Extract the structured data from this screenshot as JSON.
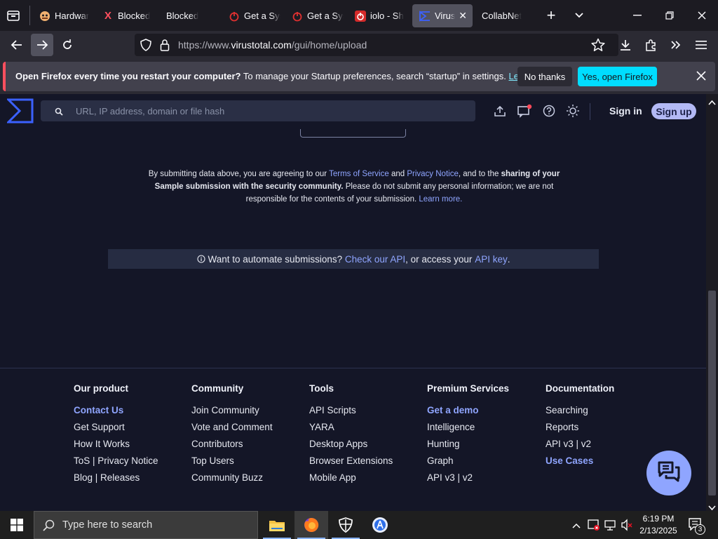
{
  "browser": {
    "tabs": [
      {
        "label": "Hardwar",
        "icon": "smiley-favicon-icon"
      },
      {
        "label": "Blocked",
        "icon": "x-favicon-icon"
      },
      {
        "label": "Blocked",
        "icon": ""
      },
      {
        "label": "Get a Sys",
        "icon": "power-favicon-icon"
      },
      {
        "label": "Get a Sys",
        "icon": "power-favicon-icon"
      },
      {
        "label": "iolo - Sh",
        "icon": "power-square-favicon-icon"
      },
      {
        "label": "Virus",
        "icon": "virustotal-favicon-icon"
      },
      {
        "label": "CollabNet",
        "icon": ""
      }
    ],
    "url_prefix": "https://www.",
    "url_domain": "virustotal.com",
    "url_path": "/gui/home/upload"
  },
  "notification": {
    "bold_text": "Open Firefox every time you restart your computer?",
    "text": " To manage your Startup preferences, search “startup” in settings.",
    "learn_more": "Learn more",
    "no_thanks": "No thanks",
    "yes": "Yes, open Firefox"
  },
  "header": {
    "search_placeholder": "URL, IP address, domain or file hash",
    "sign_in": "Sign in",
    "sign_up": "Sign up"
  },
  "terms": {
    "p1": "By submitting data above, you are agreeing to our ",
    "tos": "Terms of Service",
    "and": " and ",
    "privacy": "Privacy Notice",
    "p2": ", and to the ",
    "bold": "sharing of your Sample submission with the security community.",
    "p3": " Please do not submit any personal information; we are not responsible for the contents of your submission. ",
    "learn_more": "Learn more."
  },
  "api_banner": {
    "icon": "info-icon",
    "text1": "Want to automate submissions? ",
    "link1": "Check our API",
    "text2": ", or access your ",
    "link2": "API key",
    "text3": "."
  },
  "footer": {
    "columns": [
      {
        "title": "Our product",
        "items": [
          "Contact Us",
          "Get Support",
          "How It Works",
          "ToS | Privacy Notice",
          "Blog | Releases"
        ]
      },
      {
        "title": "Community",
        "items": [
          "Join Community",
          "Vote and Comment",
          "Contributors",
          "Top Users",
          "Community Buzz"
        ]
      },
      {
        "title": "Tools",
        "items": [
          "API Scripts",
          "YARA",
          "Desktop Apps",
          "Browser Extensions",
          "Mobile App"
        ]
      },
      {
        "title": "Premium Services",
        "items": [
          "Get a demo",
          "Intelligence",
          "Hunting",
          "Graph",
          "API v3 | v2"
        ]
      },
      {
        "title": "Documentation",
        "items": [
          "Searching",
          "Reports",
          "API v3 | v2",
          "Use Cases"
        ]
      }
    ]
  },
  "taskbar": {
    "search_placeholder": "Type here to search",
    "time": "6:19 PM",
    "date": "2/13/2025",
    "notification_count": "3"
  }
}
